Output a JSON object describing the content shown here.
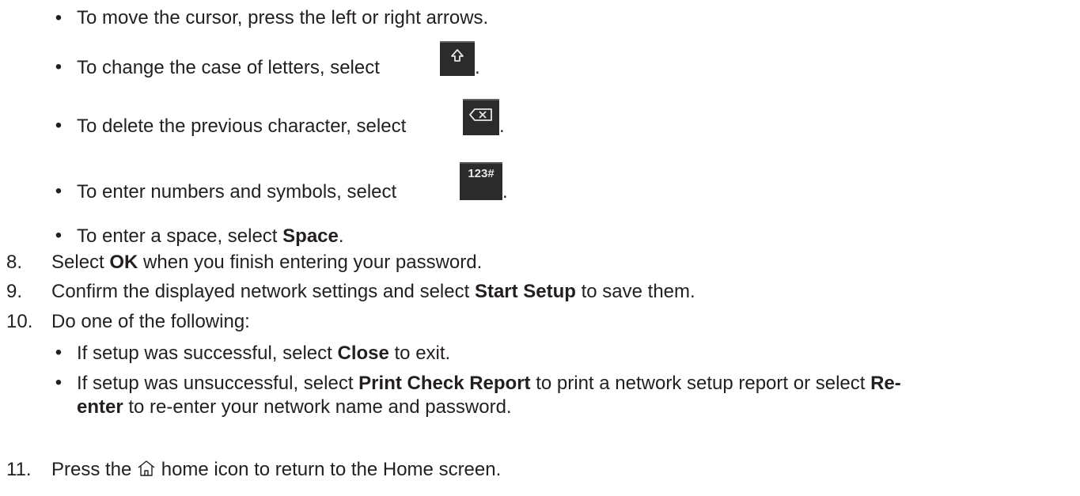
{
  "bullets_top": {
    "cursor": "To move the cursor, press the left or right arrows.",
    "case_prefix": "To change the case of letters, select",
    "delete_prefix": "To delete the previous character, select",
    "numbers_prefix": "To enter numbers and symbols, select",
    "numbers_icon_text": "123#",
    "space_prefix": "To enter a space, select ",
    "space_bold": "Space",
    "period": "."
  },
  "steps": [
    {
      "num": "8.",
      "pre": "Select ",
      "bold": "OK",
      "post": " when you finish entering your password."
    },
    {
      "num": "9.",
      "pre": "Confirm the displayed network settings and select ",
      "bold": "Start Setup",
      "post": " to save them."
    },
    {
      "num": "10.",
      "text": "Do one of the following:"
    },
    {
      "num": "11.",
      "pre": "Press the ",
      "post": " home icon to return to the Home screen."
    }
  ],
  "sub_bullets": {
    "success_pre": "If setup was successful, select ",
    "success_bold": "Close",
    "success_post": " to exit.",
    "fail_pre": "If setup was unsuccessful, select ",
    "fail_bold1": "Print Check Report",
    "fail_mid": " to print a network setup report or select ",
    "fail_bold2a": "Re-",
    "fail_bold2b": "enter",
    "fail_post": " to re-enter your network name and password."
  },
  "icons": [
    "shift-arrow-icon",
    "backspace-icon",
    "numbers-symbols-icon",
    "home-icon"
  ]
}
